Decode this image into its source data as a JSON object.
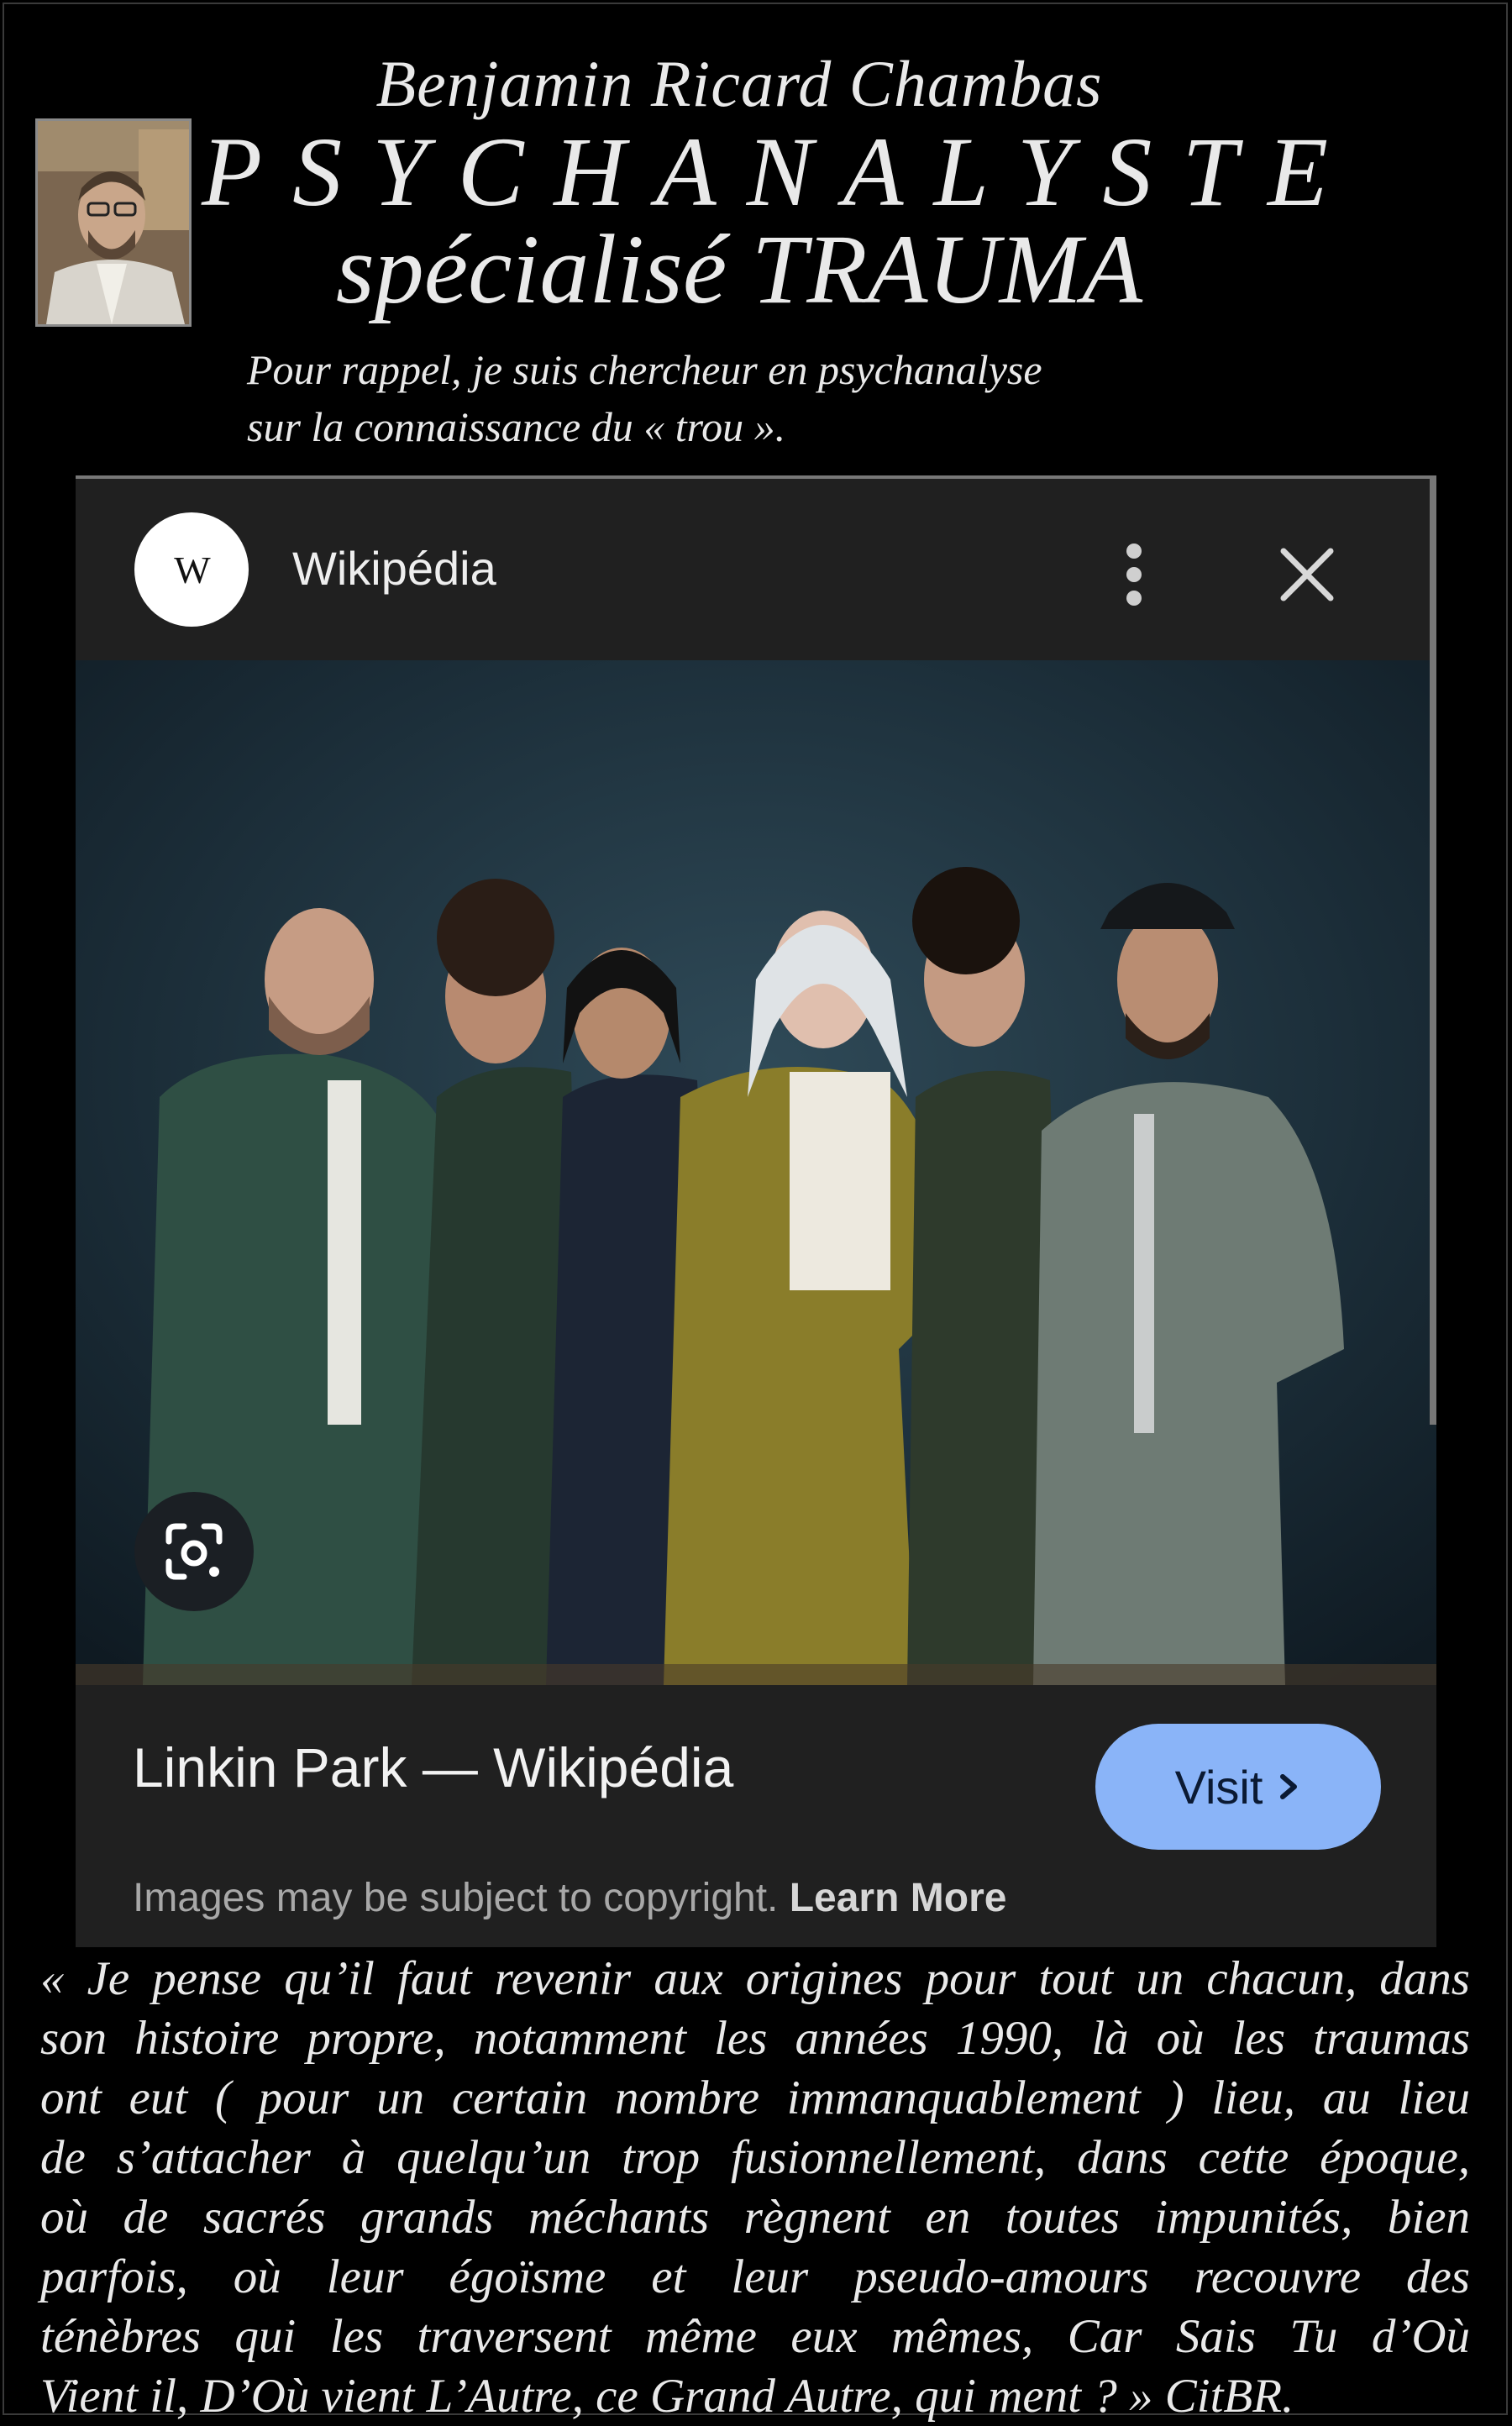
{
  "header": {
    "name": "Benjamin Ricard Chambas",
    "title": "PSYCHANALYSTE",
    "subtitle": "spécialisé TRAUMA",
    "intro_line1": "Pour rappel, je suis chercheur en psychanalyse",
    "intro_line2": "sur la connaissance du « trou »."
  },
  "card": {
    "source_logo": "W",
    "source_name": "Wikipédia",
    "menu_icon": "more-vert-icon",
    "close_icon": "close-icon",
    "lens_icon": "google-lens-icon",
    "result_title": "Linkin Park — Wikipédia",
    "visit_label": "Visit",
    "copyright_text": "Images may be subject to copyright.",
    "learn_more": "Learn More",
    "accent_color": "#8ab4f8"
  },
  "quote": {
    "lines": [
      "« Je pense qu’il faut revenir aux origines pour tout un chacun, dans",
      "son histoire propre, notamment les années 1990, là où les traumas",
      "ont eut ( pour un certain nombre immanquablement ) lieu, au lieu",
      "de s’attacher à quelqu’un trop fusionnellement, dans cette époque,",
      "où de sacrés grands méchants règnent en toutes impunités, bien",
      "parfois, où leur égoïsme et leur pseudo-amours recouvre des",
      "ténèbres qui les traversent même eux mêmes, Car Sais Tu d’Où",
      "Vient il, D’Où vient L’Autre, ce Grand Autre, qui ment ? » CitBR."
    ]
  }
}
